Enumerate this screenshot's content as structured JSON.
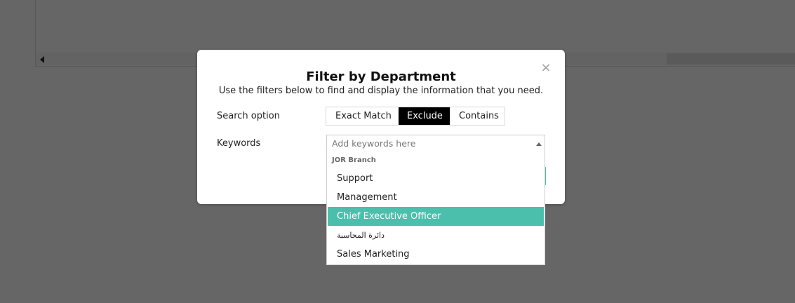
{
  "modal": {
    "title": "Filter by Department",
    "subtitle": "Use the filters below to find and display the information that you need.",
    "close_icon": "×",
    "search_option_label": "Search option",
    "search_options": [
      "Exact Match",
      "Exclude",
      "Contains"
    ],
    "active_search_option": "Exclude",
    "keywords_label": "Keywords",
    "keywords_placeholder": "Add keywords here"
  },
  "dropdown": {
    "group_label": "JOR Branch",
    "options": [
      "Support",
      "Management",
      "Chief Executive Officer",
      "دائرة المحاسبة",
      "Sales Marketing"
    ],
    "highlighted_option": "Chief Executive Officer"
  },
  "colors": {
    "overlay": "#666666",
    "accent": "#4bbfab",
    "active_toggle": "#000000"
  }
}
